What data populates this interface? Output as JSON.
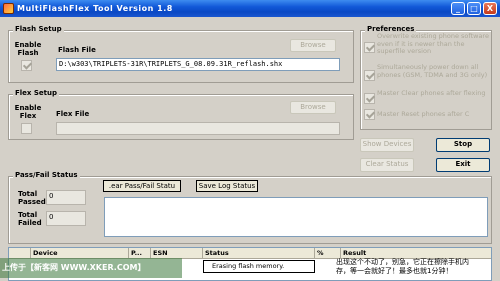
{
  "window": {
    "title": "MultiFlashFlex Tool Version 1.8",
    "minimize": "_",
    "maximize": "□",
    "close": "X"
  },
  "flash_setup": {
    "title": "Flash Setup",
    "enable_label": "Enable\nFlash",
    "file_label": "Flash File",
    "file_value": "D:\\w303\\TRIPLETS-31R\\TRIPLETS_G_08.09.31R_reflash.shx",
    "browse_label": "Browse",
    "enable_checked": true
  },
  "flex_setup": {
    "title": "Flex Setup",
    "enable_label": "Enable\nFlex",
    "file_label": "Flex File",
    "file_value": "",
    "browse_label": "Browse",
    "enable_checked": false
  },
  "preferences": {
    "title": "Preferences",
    "items": [
      {
        "label": "Overwrite existing phone software even if it is newer than the superfile version",
        "checked": true
      },
      {
        "label": "Simultaneously power down all phones (GSM, TDMA and 3G only)",
        "checked": true
      },
      {
        "label": "Master Clear phones after flexing",
        "checked": true
      },
      {
        "label": "Master Reset phones after C",
        "checked": true
      }
    ]
  },
  "actions": {
    "show_devices": "Show Devices",
    "stop": "Stop",
    "clear_status": "Clear Status",
    "exit": "Exit"
  },
  "pass_fail": {
    "title": "Pass/Fail Status",
    "total_passed_label": "Total\nPassed",
    "total_passed_value": "0",
    "total_failed_label": "Total\nFailed",
    "total_failed_value": "0",
    "clear_button": ".ear Pass/Fail Statu",
    "save_log_button": "Save Log Status"
  },
  "device_grid": {
    "columns": [
      "Device",
      "P...",
      "ESN",
      "Status",
      "%",
      "Result"
    ],
    "rows": [
      {
        "device": "",
        "port": "",
        "esn": "",
        "status": "Erasing flash memory.",
        "percent": "",
        "result": ""
      }
    ]
  },
  "watermark": "上传于【新客网 WWW.XKER.COM】",
  "caption_line1": "出现这个不动了，别急，它正在擦除手机内",
  "caption_line2": "存，等一会就好了！最多也就1分钟！"
}
